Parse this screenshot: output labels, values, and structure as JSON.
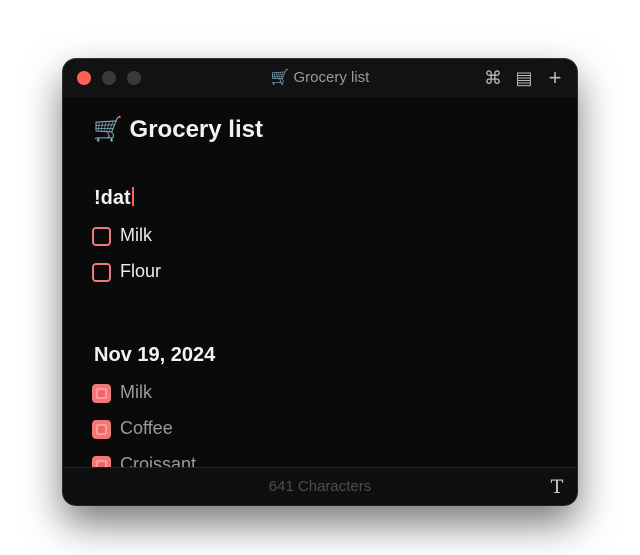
{
  "window": {
    "title": "🛒 Grocery list"
  },
  "toolbar": {
    "icons": [
      "command-icon",
      "notes-list-icon",
      "plus-icon"
    ],
    "command_glyph": "⌘",
    "list_glyph": "▤",
    "plus_glyph": "+"
  },
  "document": {
    "title": "🛒 Grocery list",
    "sections": [
      {
        "heading": "!dat",
        "items": [
          {
            "label": "Milk",
            "checked": false
          },
          {
            "label": "Flour",
            "checked": false
          }
        ]
      },
      {
        "heading": "Nov 19, 2024",
        "items": [
          {
            "label": "Milk",
            "checked": true
          },
          {
            "label": "Coffee",
            "checked": true
          },
          {
            "label": "Croissant",
            "checked": true
          }
        ]
      }
    ]
  },
  "footer": {
    "char_count": "641 Characters",
    "font_glyph": "T"
  },
  "colors": {
    "accent": "#f07878",
    "close": "#ff5f57",
    "background": "#0a0a0a"
  }
}
